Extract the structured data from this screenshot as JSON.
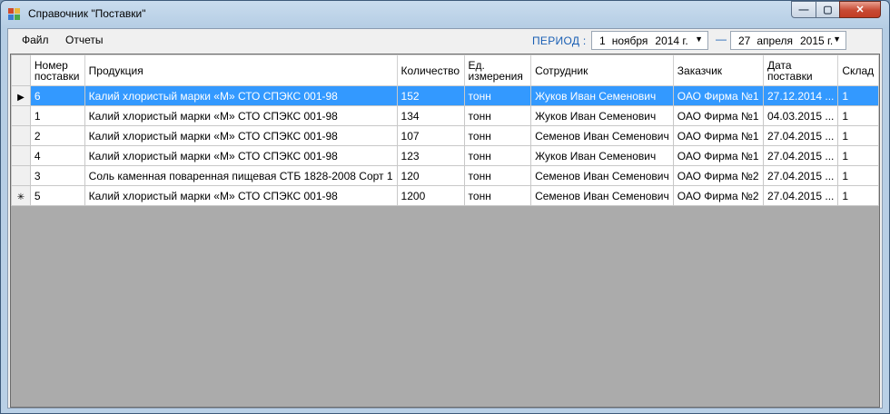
{
  "window": {
    "title": "Справочник \"Поставки\""
  },
  "controls": {
    "minimize": "—",
    "maximize": "▢",
    "close": "✕"
  },
  "menu": {
    "file": "Файл",
    "reports": "Отчеты"
  },
  "period": {
    "label": "ПЕРИОД :",
    "dash": "—",
    "from": {
      "day": "1",
      "month": "ноября",
      "year": "2014 г."
    },
    "to": {
      "day": "27",
      "month": "апреля",
      "year": "2015 г."
    }
  },
  "grid": {
    "columns": [
      {
        "line1": "Номер",
        "line2": "поставки"
      },
      {
        "line1": "Продукция",
        "line2": ""
      },
      {
        "line1": "Количество",
        "line2": ""
      },
      {
        "line1": "Ед.",
        "line2": "измерения"
      },
      {
        "line1": "Сотрудник",
        "line2": ""
      },
      {
        "line1": "Заказчик",
        "line2": ""
      },
      {
        "line1": "Дата",
        "line2": "поставки"
      },
      {
        "line1": "Склад",
        "line2": ""
      }
    ],
    "rows": [
      {
        "indicator": "▶",
        "cells": [
          "6",
          "Калий хлористый марки «М» СТО СПЭКС 001-98",
          "152",
          "тонн",
          "Жуков Иван Семенович",
          "ОАО Фирма №1",
          "27.12.2014 ...",
          "1"
        ]
      },
      {
        "indicator": "",
        "cells": [
          "1",
          "Калий хлористый марки «М» СТО СПЭКС 001-98",
          "134",
          "тонн",
          "Жуков Иван Семенович",
          "ОАО Фирма №1",
          "04.03.2015 ...",
          "1"
        ]
      },
      {
        "indicator": "",
        "cells": [
          "2",
          "Калий хлористый марки «М» СТО СПЭКС 001-98",
          "107",
          "тонн",
          "Семенов Иван Семенович",
          "ОАО Фирма №1",
          "27.04.2015 ...",
          "1"
        ]
      },
      {
        "indicator": "",
        "cells": [
          "4",
          "Калий хлористый марки «М» СТО СПЭКС 001-98",
          "123",
          "тонн",
          "Жуков Иван Семенович",
          "ОАО Фирма №1",
          "27.04.2015 ...",
          "1"
        ]
      },
      {
        "indicator": "",
        "cells": [
          "3",
          "Соль каменная поваренная пищевая СТБ  1828-2008 Сорт 1",
          "120",
          "тонн",
          "Семенов Иван Семенович",
          "ОАО Фирма №2",
          "27.04.2015 ...",
          "1"
        ]
      },
      {
        "indicator": "✳",
        "cells": [
          "5",
          "Калий хлористый марки «М» СТО СПЭКС 001-98",
          "1200",
          "тонн",
          "Семенов Иван Семенович",
          "ОАО Фирма №2",
          "27.04.2015 ...",
          "1"
        ]
      }
    ],
    "selected_row": 0
  },
  "icons": {
    "app": "app-window-icon",
    "dropdown": "dropdown-arrow-icon",
    "current_row": "current-row-icon",
    "new_row": "new-row-icon"
  },
  "colors": {
    "selection": "#3399ff",
    "period_label": "#1a5fb4",
    "grid_background": "#ababab"
  }
}
